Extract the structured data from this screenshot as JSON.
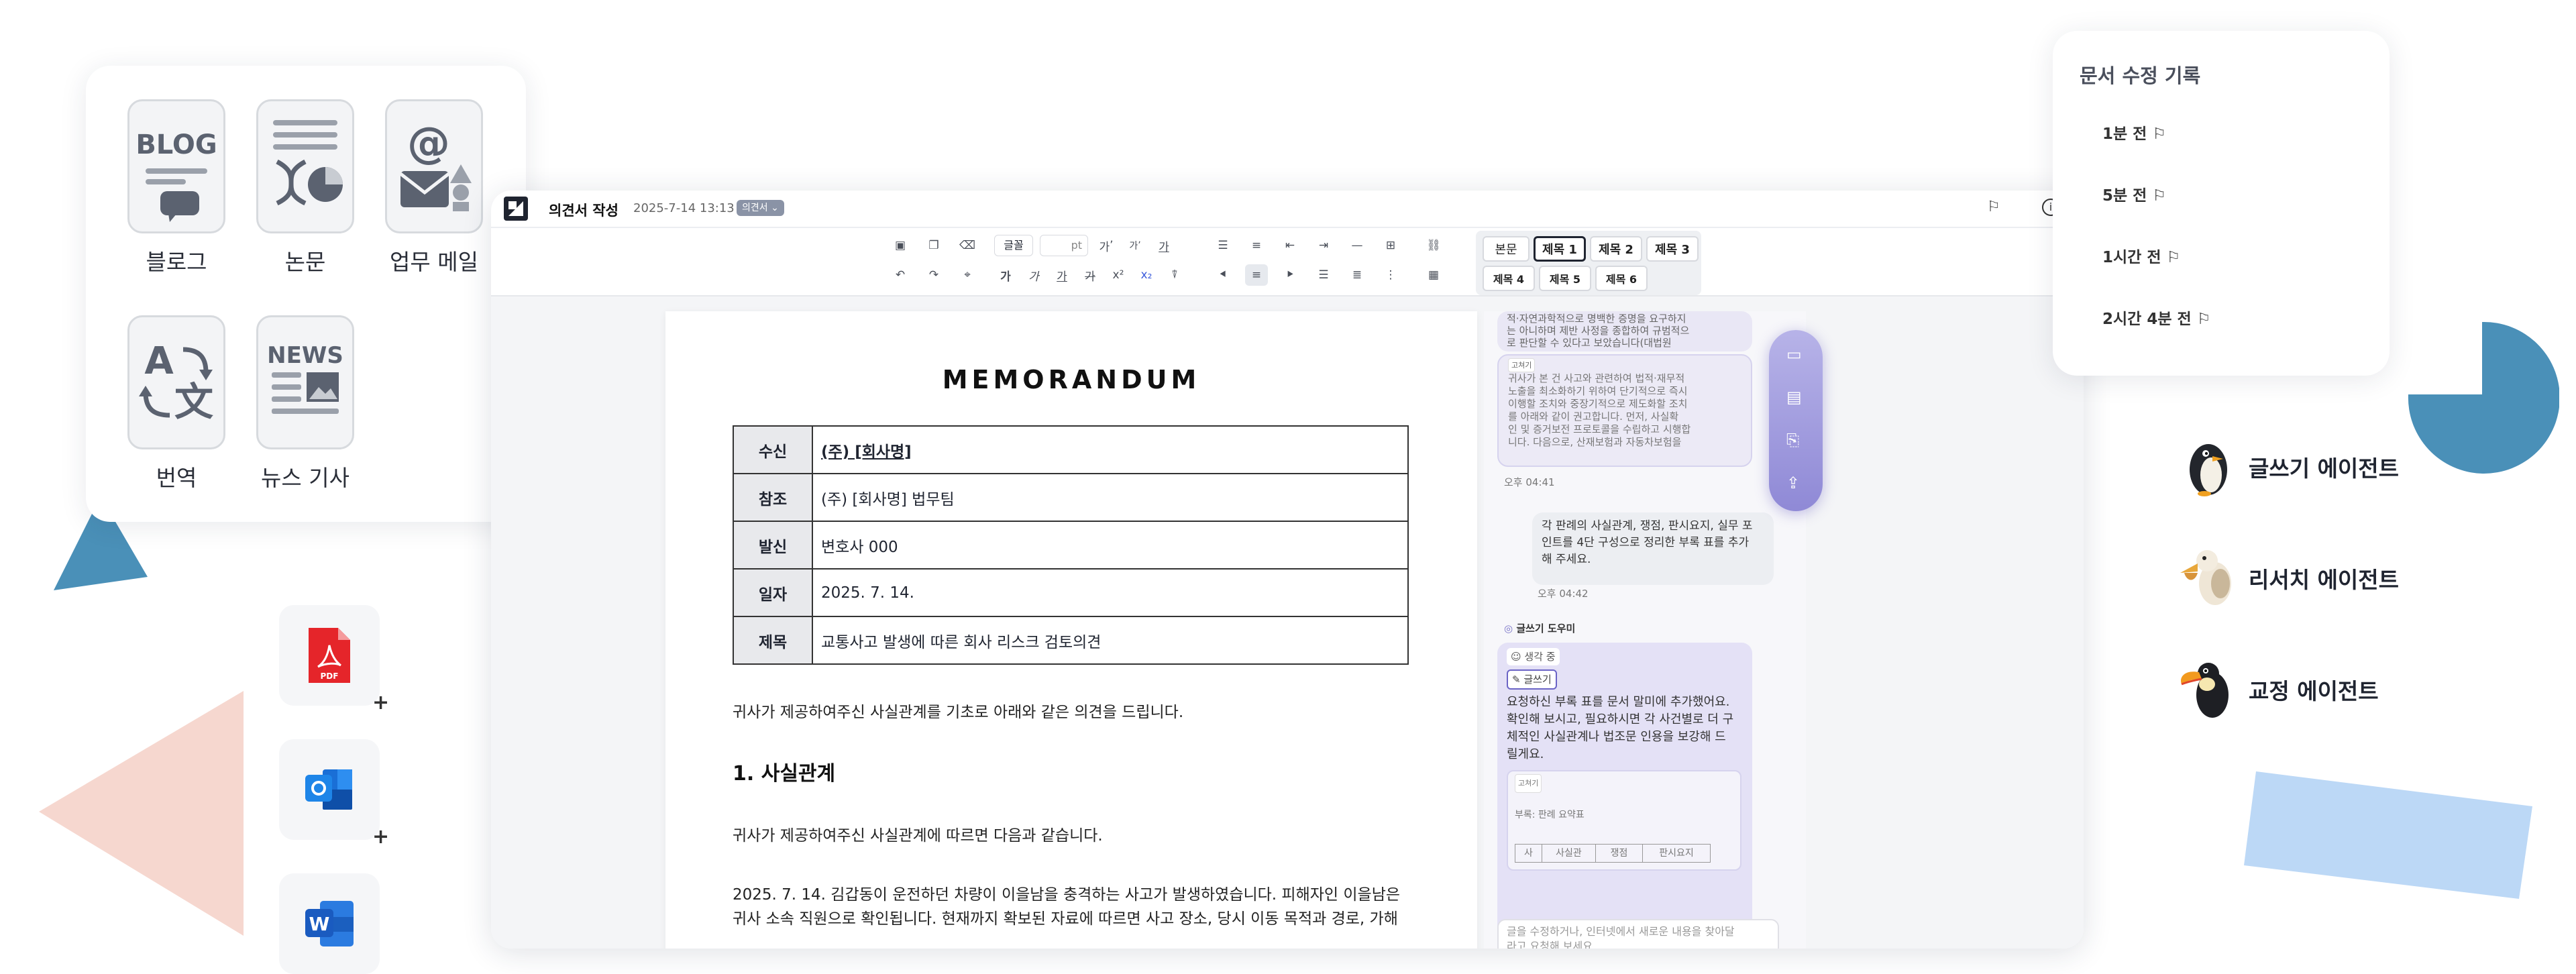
{
  "apps": [
    {
      "label": "블로그",
      "icon": "blog-icon",
      "icon_text": "BLOG"
    },
    {
      "label": "논문",
      "icon": "paper-icon"
    },
    {
      "label": "업무 메일",
      "icon": "mail-icon"
    },
    {
      "label": "번역",
      "icon": "translate-icon"
    },
    {
      "label": "뉴스 기사",
      "icon": "news-icon",
      "icon_text": "NEWS"
    }
  ],
  "files": [
    {
      "icon": "pdf-icon",
      "text": "PDF"
    },
    {
      "icon": "outlook-icon"
    },
    {
      "icon": "word-icon",
      "text": "W"
    }
  ],
  "window": {
    "title": "의견서 작성",
    "datetime": "2025-7-14 13:13",
    "badge": "의견서"
  },
  "toolbar": {
    "font_label": "글꼴",
    "size_unit": "pt",
    "styles_row1": [
      "본문",
      "제목 1",
      "제목 2",
      "제목 3"
    ],
    "styles_row2": [
      "제목 4",
      "제목 5",
      "제목 6"
    ],
    "selected_style": "제목 1",
    "format_glyphs": [
      "가",
      "가",
      "가",
      "가",
      "x²",
      "x₂"
    ],
    "size_glyphs": [
      "가",
      "가"
    ]
  },
  "document": {
    "title": "MEMORANDUM",
    "table": [
      {
        "key": "수신",
        "value": "(주) [회사명]"
      },
      {
        "key": "참조",
        "value": "(주) [회사명] 법무팀"
      },
      {
        "key": "발신",
        "value": "변호사 000"
      },
      {
        "key": "일자",
        "value": "2025. 7. 14."
      },
      {
        "key": "제목",
        "value": "교통사고 발생에 따른 회사 리스크 검토의견"
      }
    ],
    "intro": "귀사가 제공하여주신 사실관계를 기초로 아래와 같은 의견을 드립니다.",
    "section1_title": "1. 사실관계",
    "section1_intro": "귀사가 제공하여주신 사실관계에 따르면 다음과 같습니다.",
    "para_line1": "2025. 7. 14. 김갑동이 운전하던 차량이 이을남을 충격하는 사고가 발생하였습니다. 피해자인 이을남은",
    "para_line2": "귀사 소속 직원으로 확인됩니다. 현재까지 확보된 자료에 따르면 사고 장소, 당시 이동 목적과 경로, 가해"
  },
  "chat": {
    "snippet1_line1": "적·자연과학적으로 명백한 증명을 요구하지",
    "snippet1_line2": "는 아니하며 제반 사정을 종합하여 규범적으",
    "snippet1_line3": "로 판단할 수 있다고 보았습니다(대법원",
    "snippet2_tag": "고쳐기",
    "snippet2_lines": [
      "귀사가 본 건 사고와 관련하여 법적·재무적",
      "노출을 최소화하기 위하여 단기적으로 즉시",
      "이행할 조치와 중장기적으로 제도화할 조치",
      "를 아래와 같이 권고합니다. 먼저, 사실확",
      "인 및 증거보전 프로토콜을 수립하고 시행합",
      "니다. 다음으로, 산재보험과 자동차보험을"
    ],
    "time1": "오후 04:41",
    "user_msg": [
      "각 판례의 사실관계, 쟁점, 판시요지, 실무 포",
      "인트를 4단 구성으로 정리한 부록 표를 추가",
      "해 주세요."
    ],
    "time2": "오후 04:42",
    "assistant_name": "글쓰기 도우미",
    "thinking": "생각 중",
    "tool_tag": "글쓰기",
    "reply": [
      "요청하신 부록 표를 문서 말미에 추가했어요.",
      "확인해 보시고, 필요하시면 각 사건별로 더 구",
      "체적인 사실관계나 법조문 인용을 보강해 드",
      "릴게요."
    ],
    "snippet3_tag": "고쳐기",
    "snippet3_text": "부록: 판례 요약표",
    "mini_table": [
      "사",
      "사실관",
      "쟁점",
      "판시요지"
    ],
    "input_placeholder_line1": "글을 수정하거나, 인터넷에서 새로운 내용을 찾아달",
    "input_placeholder_line2": "라고 요청해 보세요"
  },
  "history": {
    "title": "문서 수정 기록",
    "items": [
      "1분 전",
      "5분 전",
      "1시간 전",
      "2시간 4분 전"
    ]
  },
  "agents": [
    {
      "label": "글쓰기 에이전트",
      "icon": "penguin-icon"
    },
    {
      "label": "리서치 에이전트",
      "icon": "pelican-icon"
    },
    {
      "label": "교정 에이전트",
      "icon": "toucan-icon"
    }
  ],
  "colors": {
    "accent_blue": "#4a90b8",
    "triangle_pink": "#f6d7cf",
    "light_blue": "#bcd8f6",
    "fab_purple": "#9f99dc",
    "bubble_purple": "#e2dff6"
  }
}
